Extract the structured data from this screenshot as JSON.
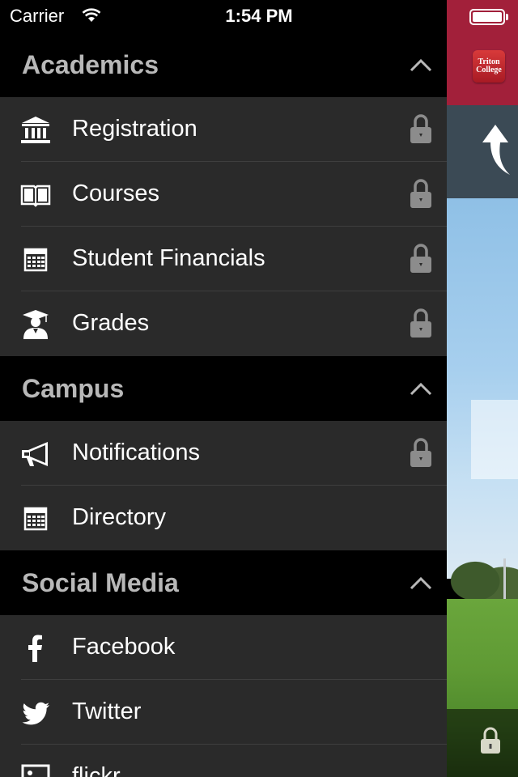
{
  "status_bar": {
    "carrier": "Carrier",
    "time": "1:54 PM"
  },
  "app": {
    "logo_text_line1": "Triton",
    "logo_text_line2": "College",
    "brand_color": "#a2203a"
  },
  "sections": [
    {
      "title": "Academics",
      "items": [
        {
          "label": "Registration",
          "icon": "bank-icon",
          "locked": true
        },
        {
          "label": "Courses",
          "icon": "book-icon",
          "locked": true
        },
        {
          "label": "Student Financials",
          "icon": "calculator-icon",
          "locked": true
        },
        {
          "label": "Grades",
          "icon": "graduate-icon",
          "locked": true
        }
      ]
    },
    {
      "title": "Campus",
      "items": [
        {
          "label": "Notifications",
          "icon": "megaphone-icon",
          "locked": true
        },
        {
          "label": "Directory",
          "icon": "calculator-icon",
          "locked": false
        }
      ]
    },
    {
      "title": "Social Media",
      "items": [
        {
          "label": "Facebook",
          "icon": "facebook-icon",
          "locked": false
        },
        {
          "label": "Twitter",
          "icon": "twitter-icon",
          "locked": false
        },
        {
          "label": "flickr",
          "icon": "image-icon",
          "locked": false
        }
      ]
    }
  ]
}
